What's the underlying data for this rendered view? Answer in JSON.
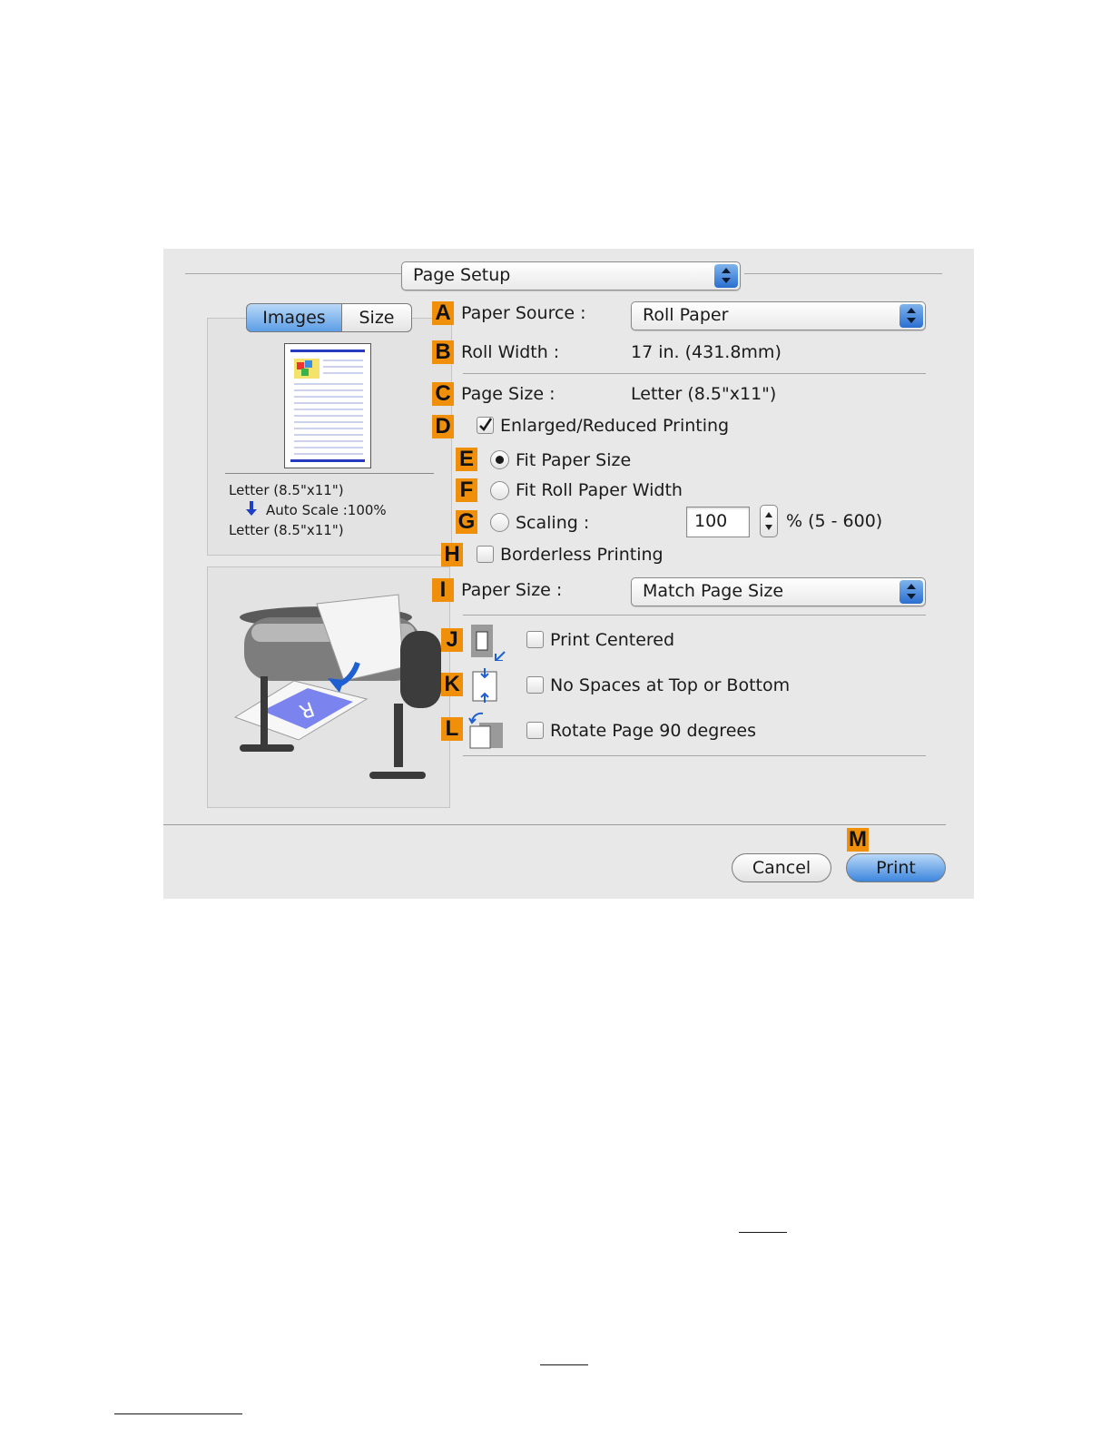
{
  "dialog": {
    "panel_popup": {
      "value": "Page Setup"
    },
    "tabs": [
      {
        "label": "Images",
        "selected": true
      },
      {
        "label": "Size",
        "selected": false
      }
    ],
    "preview": {
      "line1": "Letter (8.5\"x11\")",
      "line2": "Auto Scale :100%",
      "line3": "Letter (8.5\"x11\")"
    },
    "badges": [
      "A",
      "B",
      "C",
      "D",
      "E",
      "F",
      "G",
      "H",
      "I",
      "J",
      "K",
      "L",
      "M"
    ],
    "paper_source": {
      "label": "Paper Source :",
      "value": "Roll Paper"
    },
    "roll_width": {
      "label": "Roll Width :",
      "value": "17 in. (431.8mm)"
    },
    "page_size": {
      "label": "Page Size :",
      "value": "Letter (8.5\"x11\")"
    },
    "enlarged_reduced": {
      "label": "Enlarged/Reduced Printing",
      "checked": true
    },
    "fit_paper_size": {
      "label": "Fit Paper Size",
      "selected": true
    },
    "fit_roll_width": {
      "label": "Fit Roll Paper Width",
      "selected": false
    },
    "scaling": {
      "label": "Scaling :",
      "value": "100",
      "range": "% (5 - 600)"
    },
    "borderless": {
      "label": "Borderless Printing",
      "checked": false
    },
    "paper_size": {
      "label": "Paper Size :",
      "value": "Match Page Size"
    },
    "print_centered": {
      "label": "Print Centered",
      "checked": false
    },
    "no_spaces": {
      "label": "No Spaces at Top or Bottom",
      "checked": false
    },
    "rotate": {
      "label": "Rotate Page 90 degrees",
      "checked": false
    },
    "buttons": {
      "cancel": "Cancel",
      "print": "Print"
    },
    "colors": {
      "badge": "#f0900a",
      "accent": "#3d86de",
      "dialog_bg": "#e8e8e8"
    }
  }
}
